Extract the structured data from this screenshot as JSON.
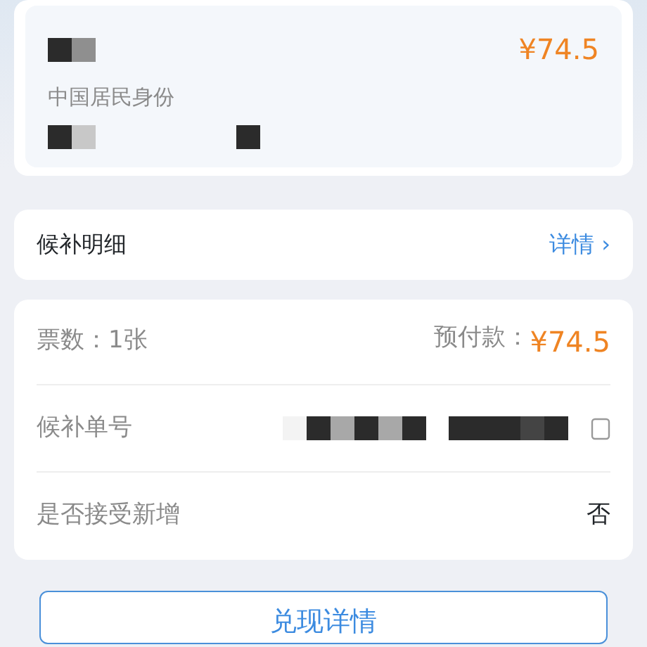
{
  "passenger": {
    "id_type": "中国居民身份",
    "price": "¥74.5"
  },
  "detail_row": {
    "label": "候补明细",
    "link": "详情",
    "chevron": "›"
  },
  "summary": {
    "tickets_label": "票数：",
    "tickets": "1张",
    "prepay_label": "预付款：",
    "prepay": "¥74.5"
  },
  "rows": [
    {
      "label": "候补单号",
      "kind": "redacted"
    },
    {
      "label": "是否接受新增",
      "kind": "value",
      "value": "否"
    }
  ],
  "button": "兑现详情"
}
